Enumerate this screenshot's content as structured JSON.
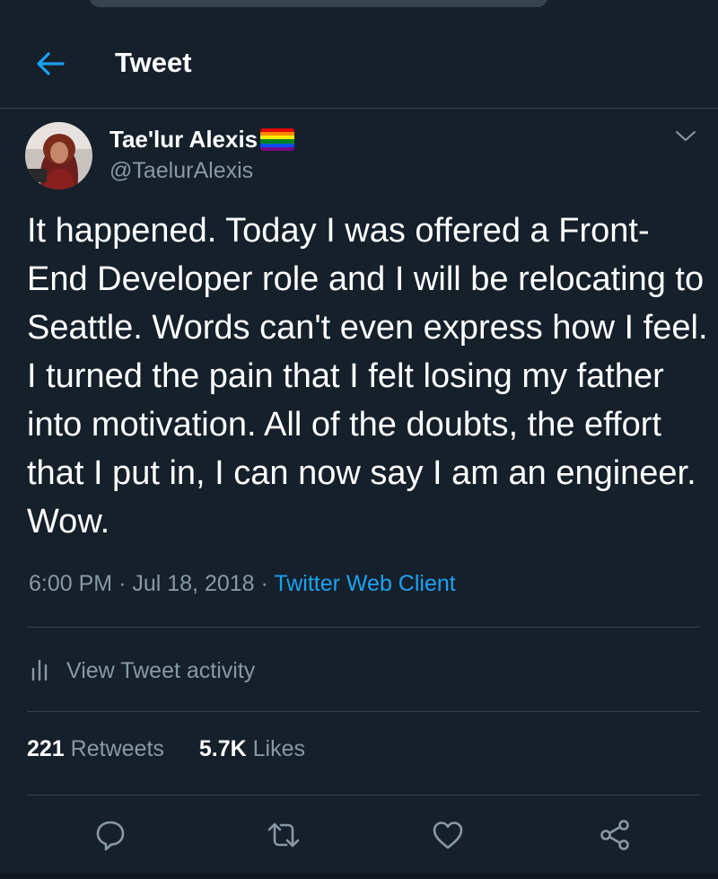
{
  "header": {
    "back_icon": "arrow-left-icon",
    "title": "Tweet"
  },
  "tweet": {
    "author": {
      "name": "Tae'lur Alexis",
      "handle": "@TaelurAlexis",
      "badge": "rainbow-flag-emoji"
    },
    "text": "It happened. Today I was offered a Front-End Developer role and I will be relocating to Seattle. Words can't even express how I feel. I turned the pain that I felt losing my father into motivation. All of the doubts, the effort that I put in, I can now say I am an engineer. Wow.",
    "time": "6:00 PM",
    "date": "Jul 18, 2018",
    "separator": "·",
    "source": "Twitter Web Client"
  },
  "activity": {
    "icon": "bar-chart-icon",
    "label": "View Tweet activity"
  },
  "stats": {
    "retweets_count": "221",
    "retweets_label": "Retweets",
    "likes_count": "5.7K",
    "likes_label": "Likes"
  },
  "actions": [
    {
      "icon": "reply-icon"
    },
    {
      "icon": "retweet-icon"
    },
    {
      "icon": "like-icon"
    },
    {
      "icon": "share-icon"
    }
  ],
  "colors": {
    "background": "#15202b",
    "divider": "#38444d",
    "muted_text": "#8899a6",
    "accent": "#1da1f2"
  }
}
